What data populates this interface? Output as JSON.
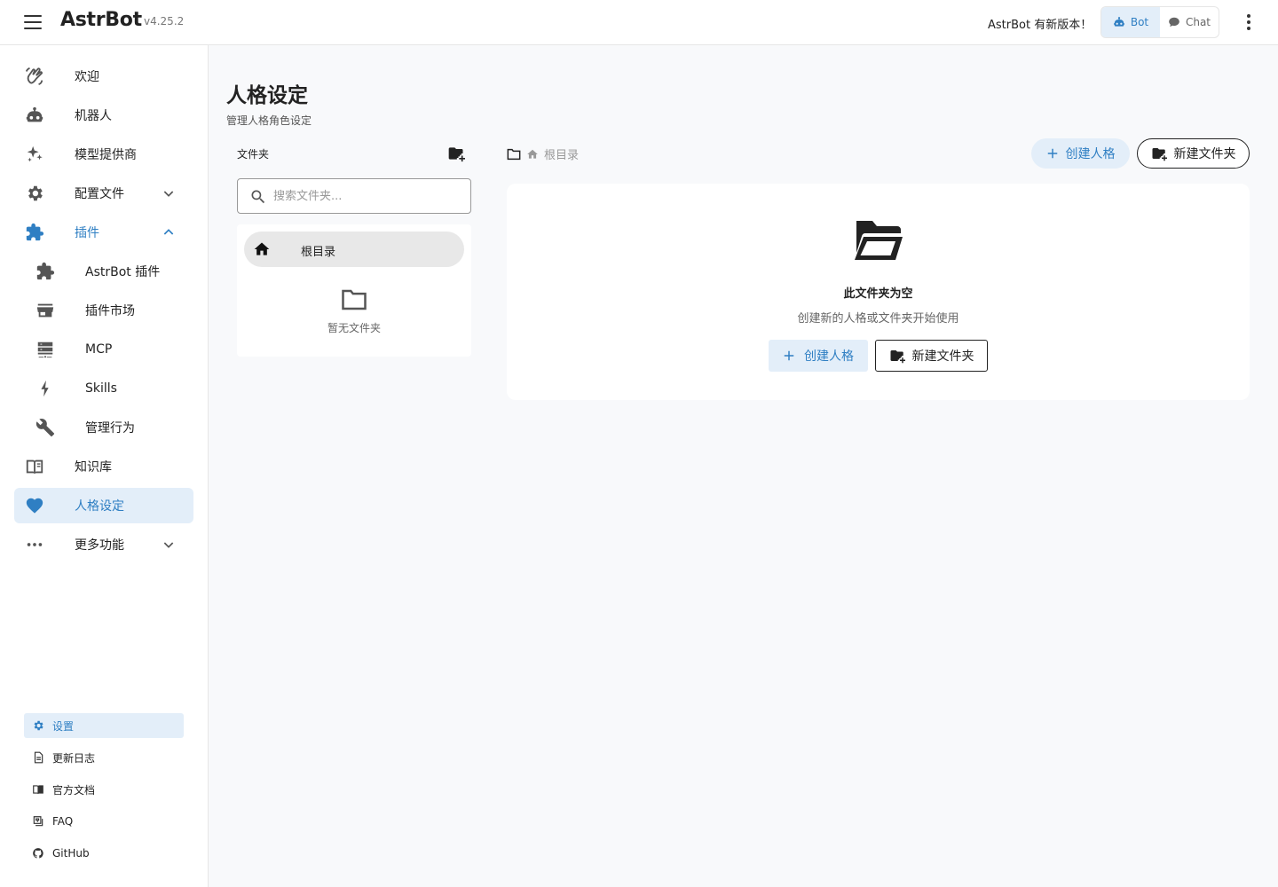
{
  "header": {
    "app_name": "AstrBot",
    "version": "v4.25.2",
    "update_notice": "AstrBot 有新版本！",
    "mode_bot": "Bot",
    "mode_chat": "Chat"
  },
  "sidebar": {
    "items": [
      {
        "label": "欢迎",
        "icon": "welcome-icon"
      },
      {
        "label": "机器人",
        "icon": "robot-icon"
      },
      {
        "label": "模型提供商",
        "icon": "sparkle-icon"
      },
      {
        "label": "配置文件",
        "icon": "gear-icon"
      },
      {
        "label": "插件",
        "icon": "puzzle-icon"
      },
      {
        "label": "AstrBot 插件",
        "icon": "puzzle-icon"
      },
      {
        "label": "插件市场",
        "icon": "store-icon"
      },
      {
        "label": "MCP",
        "icon": "server-icon"
      },
      {
        "label": "Skills",
        "icon": "bolt-icon"
      },
      {
        "label": "管理行为",
        "icon": "wrench-icon"
      },
      {
        "label": "知识库",
        "icon": "book-icon"
      },
      {
        "label": "人格设定",
        "icon": "heart-icon"
      },
      {
        "label": "更多功能",
        "icon": "dots-icon"
      }
    ],
    "footer": [
      {
        "label": "设置",
        "icon": "gear-icon"
      },
      {
        "label": "更新日志",
        "icon": "document-icon"
      },
      {
        "label": "官方文档",
        "icon": "book-icon"
      },
      {
        "label": "FAQ",
        "icon": "faq-icon"
      },
      {
        "label": "GitHub",
        "icon": "github-icon"
      }
    ]
  },
  "page": {
    "title": "人格设定",
    "subtitle": "管理人格角色设定"
  },
  "folders": {
    "panel_title": "文件夹",
    "search_placeholder": "搜索文件夹...",
    "root_label": "根目录",
    "empty_text": "暂无文件夹"
  },
  "content": {
    "breadcrumb_root": "根目录",
    "create_persona": "创建人格",
    "new_folder": "新建文件夹",
    "empty_title": "此文件夹为空",
    "empty_desc": "创建新的人格或文件夹开始使用"
  },
  "colors": {
    "accent": "#2f7fc3",
    "accent_bg": "#e3eef9",
    "icon_gray": "#555555"
  }
}
